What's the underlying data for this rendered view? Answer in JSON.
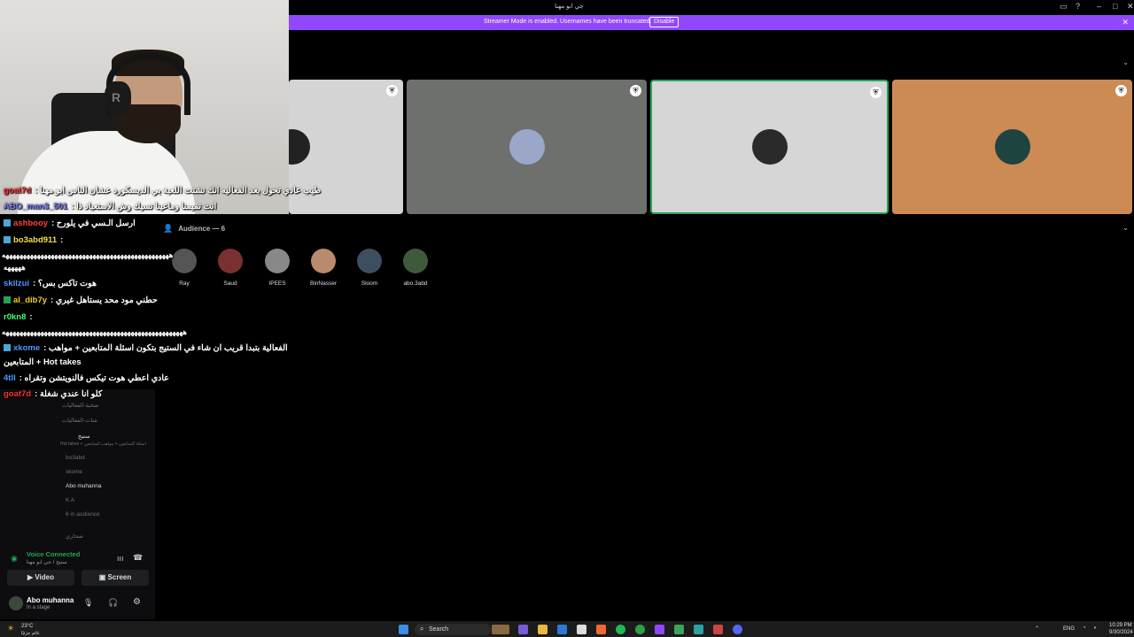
{
  "window": {
    "title": "جي ابو مهنا",
    "streamer_message": "Streamer Mode is enabled. Usernames have been truncated.",
    "streamer_button": "Disable"
  },
  "stage": {
    "tiles": [
      {
        "color": "#d4d4d4",
        "avatar": "#222"
      },
      {
        "color": "#6e706d",
        "avatar": "#9ba7c9"
      },
      {
        "color": "#d6d6d6",
        "avatar": "#2a2a2a",
        "active": true
      },
      {
        "color": "#cc8a55",
        "avatar": "#1e4440"
      }
    ]
  },
  "audience": {
    "heading": "Audience — 6",
    "members": [
      {
        "name": "Ray",
        "color": "#555"
      },
      {
        "name": "Saud",
        "color": "#7a3030"
      },
      {
        "name": "IPEES",
        "color": "#888"
      },
      {
        "name": "BinNasser",
        "color": "#b98a6b"
      },
      {
        "name": "Sloom",
        "color": "#3d4e60"
      },
      {
        "name": "abo.3abd",
        "color": "#3f5a3b"
      }
    ]
  },
  "chat": {
    "lines": [
      {
        "user": "goat7d",
        "color": "#ff3030",
        "text": "طيب عادي تحول بعد الفعاليه انك تشتت اللعبة بي الديسكورد عشان الناس ابو مهنا",
        "badge": ""
      },
      {
        "user": "ABO_man3_501",
        "color": "#7a7aff",
        "text": "انت تميمنا وماعينا تسيك وش الاستعباد ذا",
        "badge": ""
      },
      {
        "user": "ashbooy",
        "color": "#ff4040",
        "text": "ارسل الـسي في يلورح",
        "badge": "#4aa8d8"
      },
      {
        "user": "bo3abd911",
        "color": "#f0e050",
        "text": "",
        "badge": "#4aa8d8"
      },
      {
        "user": "",
        "color": "#ffffff",
        "text": "ههههههههههههههههههههههههههههههههههههههههههههههههه",
        "badge": ""
      },
      {
        "user": "",
        "color": "#ffffff",
        "text": "هههههه",
        "badge": ""
      },
      {
        "user": "skilzui",
        "color": "#4a9aff",
        "text": "هوت تاكس بس؟",
        "badge": ""
      },
      {
        "user": "al_dib7y",
        "color": "#f0d020",
        "text": "حطني مود محد يستاهل غيري",
        "badge": "#23a55a"
      },
      {
        "user": "r0kn8",
        "color": "#40ff70",
        "text": "",
        "badge": ""
      },
      {
        "user": "",
        "color": "#ffffff",
        "text": "ههههههههههههههههههههههههههههههههههههههههههههههههههههه",
        "badge": ""
      },
      {
        "user": "xkome",
        "color": "#4a9aff",
        "text": "الفعالية بتبدا قريب ان شاء في الستيج بتكون اسئلة المتابعين + مواهب",
        "badge": "#4aa8d8"
      },
      {
        "user": "",
        "color": "#ffffff",
        "text": "المتابعين + Hot takes",
        "badge": ""
      },
      {
        "user": "4tll",
        "color": "#4a9aff",
        "text": "عادي اعطي هوت تيكس فالنويتشن وتقراه",
        "badge": ""
      },
      {
        "user": "goat7d",
        "color": "#ff3030",
        "text": "كلو انا عندي شغلة",
        "badge": "#23a55a"
      }
    ]
  },
  "sidebar": {
    "channels": [
      {
        "label": "صحبة-الفعاليات"
      },
      {
        "label": "شات-الفعاليات"
      },
      {
        "label": "ستيج"
      },
      {
        "label": "Hot takes + اسئلة المتابعين + مواهب المتابعين"
      },
      {
        "label": "bo3abd"
      },
      {
        "label": "xkome"
      },
      {
        "label": "Abo muhanna"
      },
      {
        "label": "K A"
      },
      {
        "label": "6 in audience"
      },
      {
        "label": "صحاري"
      }
    ],
    "voice": {
      "status": "Voice Connected",
      "sub": "ستيج / جي ابو مهنا",
      "video": "Video",
      "screen": "Screen"
    },
    "user": {
      "name": "Abo muhanna",
      "sub": "In a stage"
    }
  },
  "taskbar": {
    "weather": "23°C",
    "weather_sub": "غائم جزئيًا",
    "search": "Search",
    "lang": "ENG",
    "time": "10:29 PM",
    "date": "9/30/2024"
  }
}
